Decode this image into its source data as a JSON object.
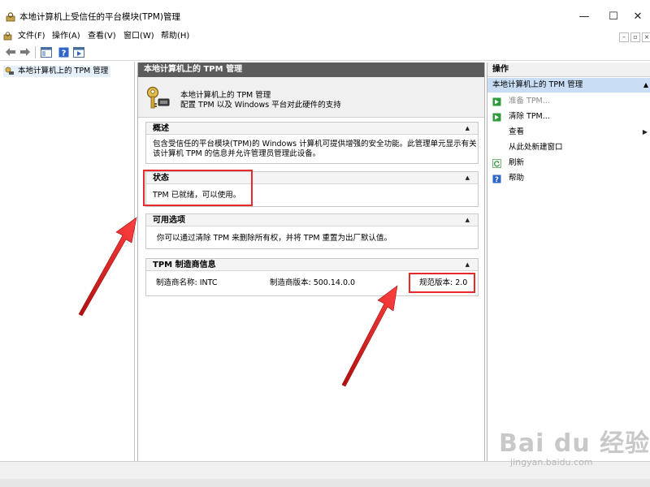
{
  "window": {
    "title": "本地计算机上受信任的平台模块(TPM)管理",
    "minimize_glyph": "—",
    "maximize_glyph": "☐",
    "close_glyph": "✕"
  },
  "menu": {
    "items": [
      "文件(F)",
      "操作(A)",
      "查看(V)",
      "窗口(W)",
      "帮助(H)"
    ],
    "mini_minimize": "–",
    "mini_restore": "▫",
    "mini_close": "×"
  },
  "toolbar": {
    "buttons": [
      "back-arrow-icon",
      "forward-arrow-icon",
      "show-hide-tree-icon",
      "help-icon",
      "show-action-pane-icon"
    ]
  },
  "tree": {
    "item_label": "本地计算机上的 TPM 管理"
  },
  "center": {
    "header": "本地计算机上的 TPM 管理",
    "intro_line1": "本地计算机上的 TPM 管理",
    "intro_line2": "配置 TPM 以及 Windows 平台对此硬件的支持",
    "overview": {
      "title": "概述",
      "body_line1": "包含受信任的平台模块(TPM)的 Windows 计算机可提供增强的安全功能。此管理单元显示有关",
      "body_line2": "该计算机 TPM 的信息并允许管理员管理此设备。"
    },
    "status": {
      "title": "状态",
      "body": "TPM 已就绪，可以使用。"
    },
    "options": {
      "title": "可用选项",
      "body": "你可以通过清除 TPM 来删除所有权，并将 TPM 重置为出厂默认值。"
    },
    "manufacturer": {
      "title": "TPM 制造商信息",
      "name": "制造商名称: INTC",
      "version": "制造商版本: 500.14.0.0",
      "spec": "规范版本: 2.0"
    },
    "caret_glyph": "▲"
  },
  "actions": {
    "header": "操作",
    "subheader": "本地计算机上的 TPM 管理",
    "items": [
      {
        "label": "准备 TPM...",
        "icon": "prepare-tpm-icon",
        "enabled": false
      },
      {
        "label": "清除 TPM...",
        "icon": "clear-tpm-icon",
        "enabled": true
      },
      {
        "label": "查看",
        "icon": "",
        "enabled": true
      },
      {
        "label": "从此处新建窗口",
        "icon": "",
        "enabled": true
      },
      {
        "label": "刷新",
        "icon": "refresh-icon",
        "enabled": true
      },
      {
        "label": "帮助",
        "icon": "help-icon",
        "enabled": true
      }
    ],
    "submenu_glyph": "▶",
    "collapse_glyph": "▲"
  },
  "watermark": {
    "brand": "Bai du 经验",
    "url": "jingyan.baidu.com"
  },
  "colors": {
    "annotation_red": "#e8292b",
    "center_header_bg": "#5c5c5c",
    "actions_sub_bg": "#c9def5",
    "action_green": "#2e9b3a",
    "help_blue": "#2f64c8"
  }
}
